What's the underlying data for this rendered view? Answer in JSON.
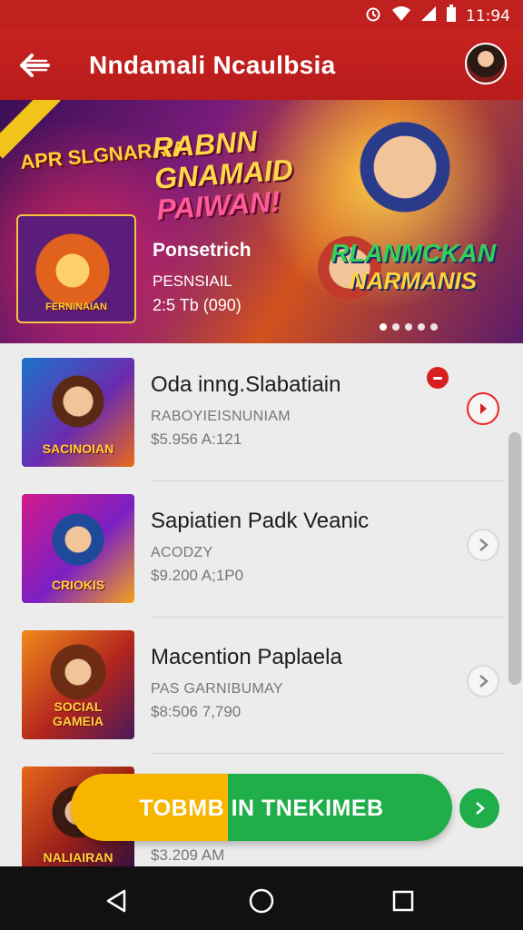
{
  "status_bar": {
    "time": "11:94",
    "icons": [
      "alarm-icon",
      "wifi-icon",
      "signal-icon",
      "battery-icon"
    ]
  },
  "app_bar": {
    "title": "Nndamali Ncaulbsia",
    "back_icon": "arrow-back-icon",
    "avatar": "user-avatar"
  },
  "banner": {
    "top_logo": "APR SLGNARAIA",
    "headline": [
      "RABNN",
      "GNAMAID",
      "PAIWAN!"
    ],
    "sub_title": "Ponsetrich",
    "sub_line1": "PESNSIAIL",
    "sub_line2": "2:5 Tb (090)",
    "brand": [
      "RLANMCKAN",
      "NARMANIS"
    ],
    "thumb_label": "FERNINAIAN",
    "page_count": 5,
    "active_page": 1
  },
  "games": [
    {
      "title": "Oda inng.Slabatiain",
      "subtitle": "RABOYIEISNUNIAM",
      "price": "$5.956 A:121",
      "thumb_label": "SACINOIAN",
      "has_notification": true,
      "chevron": "red"
    },
    {
      "title": "Sapiatien Padk Veanic",
      "subtitle": "ACODZY",
      "price": "$9.200 A;1P0",
      "thumb_label": "CRIOKIS",
      "has_notification": false,
      "chevron": "grey"
    },
    {
      "title": "Macention Paplaela",
      "subtitle": "PAS GARNIBUMAY",
      "price": "$8:506 7,790",
      "thumb_label": "SOCIAL GAMEIA",
      "has_notification": false,
      "chevron": "grey"
    },
    {
      "title": "",
      "subtitle": "",
      "price": "$3.209 AM",
      "thumb_label": "NALIAIRAN",
      "has_notification": false,
      "chevron": "none"
    }
  ],
  "cta": {
    "label": "TOBMB IN TNEKIMEB",
    "colors": {
      "left": "#f7b500",
      "right": "#1fae4a"
    }
  },
  "nav_bar": {
    "buttons": [
      "back-triangle-icon",
      "home-circle-icon",
      "recents-square-icon"
    ]
  },
  "colors": {
    "brand": "#c0201e",
    "notification": "#d81f1f"
  }
}
